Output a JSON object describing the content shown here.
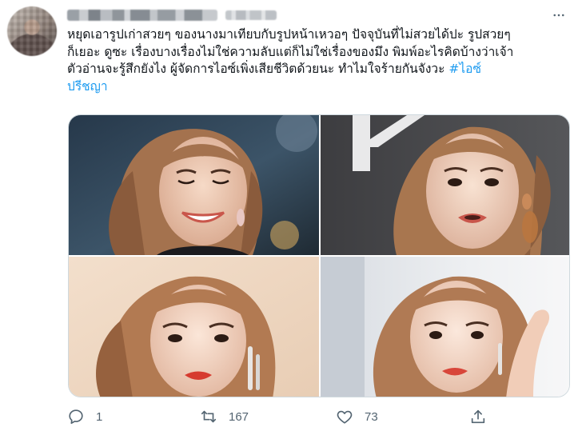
{
  "tweet": {
    "text_lines": [
      {
        "text": "หยุดเอารูปเก่าสวยๆ ของนางมาเทียบกับรูปหน้าเหวอๆ ปัจจุบันที่ไม่สวยได้ปะ รูปสวยๆ"
      },
      {
        "text": "ก็เยอะ ดูซะ เรื่องบางเรื่องไม่ใช่ความลับแต่ก็ไม่ใช่เรื่องของมึง พิมพ์อะไรคิดบ้างว่าเจ้า"
      },
      {
        "text": "ตัวอ่านจะรู้สึกยังไง ผู้จัดการไอซ์เพิ่งเสียชีวิตด้วยนะ ทำไมใจร้ายกันจังวะ ",
        "hashtag": "#ไอซ์"
      },
      {
        "text": "",
        "hashtag": "ปรีชญา"
      }
    ]
  },
  "icons": {
    "more": "more-horizontal-icon",
    "reply": "reply-icon",
    "retweet": "retweet-icon",
    "like": "like-icon",
    "share": "share-icon"
  },
  "actions": {
    "reply_count": "1",
    "retweet_count": "167",
    "like_count": "73"
  },
  "colors": {
    "text": "#0f1419",
    "muted": "#536471",
    "link": "#1d9bf0",
    "border": "#cfd9de"
  }
}
